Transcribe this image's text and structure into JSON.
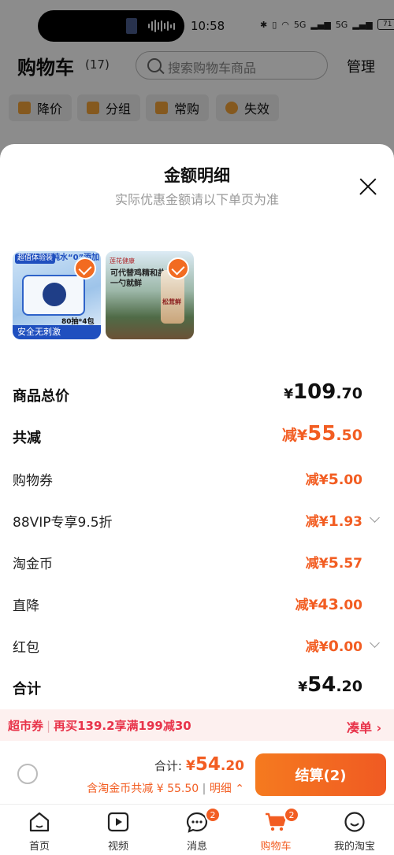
{
  "status_bar": {
    "time": "10:58",
    "network": "5G",
    "battery": "71"
  },
  "background": {
    "title": "购物车",
    "count": "(17)",
    "search_placeholder": "搜索购物车商品",
    "manage": "管理",
    "chips": [
      {
        "label": "降价",
        "icon": "down-arrow-icon"
      },
      {
        "label": "分组",
        "icon": "folder-icon"
      },
      {
        "label": "常购",
        "icon": "cart-icon"
      },
      {
        "label": "失效",
        "icon": "invalid-icon"
      }
    ]
  },
  "sheet": {
    "title": "金额明细",
    "subtitle": "实际优惠金额请以下单页为准",
    "items": [
      {
        "tag_top": "超值体验装",
        "tag_top2": "纯水“0”添加",
        "tag_bottom": "安全无刺激",
        "tag_pack": "80抽*4包"
      },
      {
        "tag_top": "可代替鸡精和盐",
        "tag_top2": "一勺就鲜",
        "brand": "莲花健康",
        "product": "松茸鲜"
      }
    ],
    "rows": [
      {
        "label": "商品总价",
        "prefix": "¥",
        "int": "109",
        "dec": ".70"
      },
      {
        "label": "共减",
        "prefix": "减¥",
        "int": "55",
        "dec": ".50"
      },
      {
        "label": "购物券",
        "prefix": "减¥",
        "int": "5",
        "dec": ".00"
      },
      {
        "label": "88VIP专享9.5折",
        "prefix": "减¥",
        "int": "1",
        "dec": ".93"
      },
      {
        "label": "淘金币",
        "prefix": "减¥",
        "int": "5",
        "dec": ".57"
      },
      {
        "label": "直降",
        "prefix": "减¥",
        "int": "43",
        "dec": ".00"
      },
      {
        "label": "红包",
        "prefix": "减¥",
        "int": "0",
        "dec": ".00"
      },
      {
        "label": "合计",
        "prefix": "¥",
        "int": "54",
        "dec": ".20"
      }
    ]
  },
  "coupon": {
    "tag": "超市券",
    "text": "再买139.2享满199减30",
    "link": "凑单"
  },
  "checkout": {
    "total_label": "合计:",
    "total_prefix": "¥",
    "total_int": "54",
    "total_dec": ".20",
    "note": "含淘金币共减 ¥ 55.50",
    "detail": "明细",
    "settle": "结算(2)"
  },
  "tabs": [
    {
      "label": "首页",
      "icon": "home-icon"
    },
    {
      "label": "视频",
      "icon": "video-icon"
    },
    {
      "label": "消息",
      "icon": "message-icon",
      "badge": "2"
    },
    {
      "label": "购物车",
      "icon": "cart-icon",
      "badge": "2",
      "active": true
    },
    {
      "label": "我的淘宝",
      "icon": "profile-icon"
    }
  ],
  "colors": {
    "accent": "#f25d22",
    "coupon": "#e8334a"
  }
}
